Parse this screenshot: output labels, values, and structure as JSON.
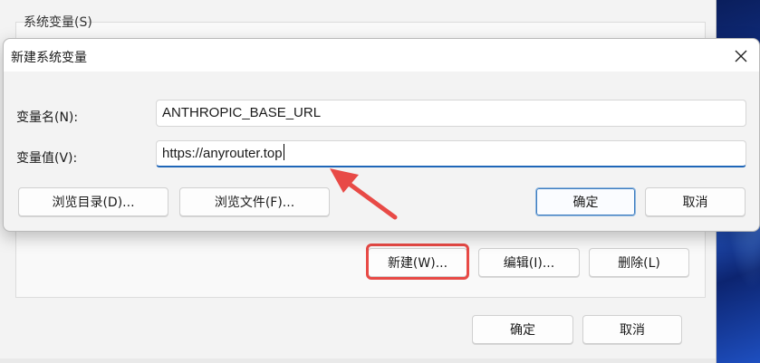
{
  "parent_window": {
    "section_label": "系统变量(S)",
    "buttons": {
      "new_label": "新建(W)...",
      "edit_label": "编辑(I)...",
      "delete_label": "删除(L)"
    },
    "footer": {
      "ok_label": "确定",
      "cancel_label": "取消"
    }
  },
  "dialog": {
    "title": "新建系统变量",
    "close_icon": "close-icon",
    "fields": {
      "name_label": "变量名(N):",
      "name_value": "ANTHROPIC_BASE_URL",
      "value_label": "变量值(V):",
      "value_value": "https://anyrouter.top"
    },
    "buttons": {
      "browse_dir_label": "浏览目录(D)...",
      "browse_file_label": "浏览文件(F)...",
      "ok_label": "确定",
      "cancel_label": "取消"
    }
  },
  "annotations": {
    "highlight_color": "#e84a46",
    "arrow_color": "#e84a46"
  }
}
